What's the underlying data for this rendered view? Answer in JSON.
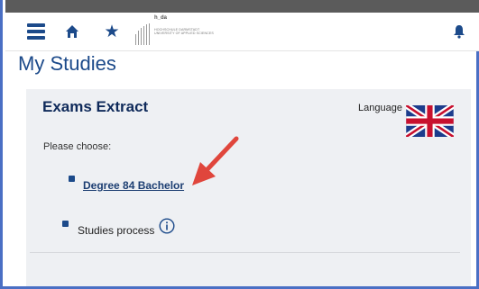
{
  "header": {
    "logo_name": "h_da",
    "logo_line1": "HOCHSCHULE DARMSTADT",
    "logo_line2": "UNIVERSITY OF APPLIED SCIENCES",
    "icons": [
      "menu-icon",
      "home-icon",
      "star-icon",
      "bell-icon"
    ]
  },
  "page": {
    "title": "My Studies"
  },
  "panel": {
    "title": "Exams Extract",
    "language_label": "Language",
    "flag": "uk-flag-icon",
    "choose_label": "Please choose:",
    "items": [
      {
        "label": "Degree 84 Bachelor"
      },
      {
        "label": "Studies process"
      }
    ]
  },
  "colors": {
    "brand_blue": "#1c4a8a",
    "frame_blue": "#4a6fc4",
    "arrow_red": "#e0463c",
    "panel_bg": "#eef0f3"
  }
}
